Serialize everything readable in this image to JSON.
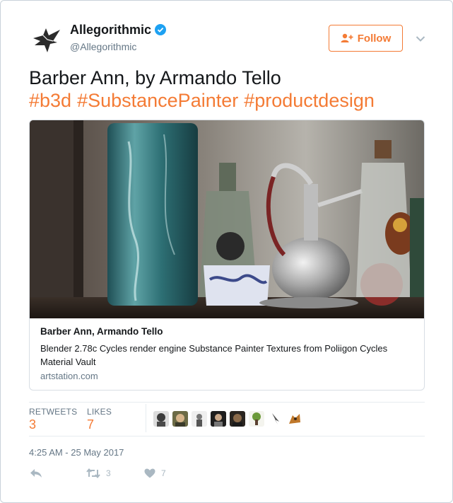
{
  "account": {
    "name": "Allegorithmic",
    "handle": "@Allegorithmic",
    "verified": true,
    "avatar_icon": "bird-logo-icon"
  },
  "follow_button": {
    "label": "Follow",
    "icon": "add-user-icon"
  },
  "menu": {
    "icon": "chevron-down-icon"
  },
  "tweet": {
    "text": "Barber Ann, by Armando Tello",
    "hashtags": [
      "#b3d",
      "#SubstancePainter",
      "#productdesign"
    ]
  },
  "card": {
    "title": "Barber Ann, Armando Tello",
    "description": "Blender 2.78c Cycles render engine Substance Painter Textures from Poliigon Cycles Material Vault",
    "domain": "artstation.com"
  },
  "stats": {
    "retweets_label": "RETWEETS",
    "retweets_value": "3",
    "likes_label": "LIKES",
    "likes_value": "7"
  },
  "liked_by_icons": [
    "avatar-1",
    "avatar-2",
    "avatar-3",
    "avatar-4",
    "avatar-5",
    "avatar-6",
    "avatar-7",
    "avatar-8"
  ],
  "timestamp": "4:25 AM - 25 May 2017",
  "actions": {
    "reply_icon": "reply-icon",
    "retweet_icon": "retweet-icon",
    "retweet_count": "3",
    "like_icon": "heart-icon",
    "like_count": "7"
  },
  "colors": {
    "accent": "#f47b35",
    "text": "#14171a",
    "muted": "#657786",
    "verified": "#1da1f2",
    "icon": "#aab8c2"
  }
}
